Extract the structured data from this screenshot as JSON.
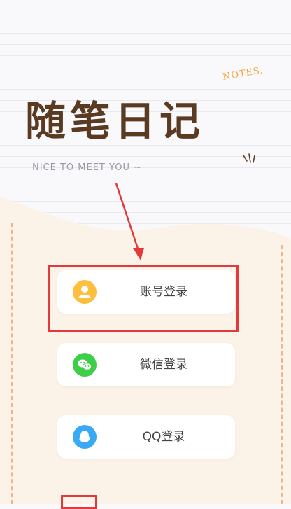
{
  "header": {
    "notes_tag": "NOTES,",
    "title": "随笔日记",
    "subtitle": "NICE TO MEET YOU ~"
  },
  "login_options": [
    {
      "label": "账号登录",
      "icon": "user-icon",
      "color": "#ffbe3b"
    },
    {
      "label": "微信登录",
      "icon": "wechat-icon",
      "color": "#3ecf4a"
    },
    {
      "label": "QQ登录",
      "icon": "qq-icon",
      "color": "#3aa9f5"
    }
  ],
  "colors": {
    "title": "#5b3a22",
    "panel": "#fbf2e8",
    "dash": "#f2b58b",
    "highlight": "#e23a3a"
  }
}
